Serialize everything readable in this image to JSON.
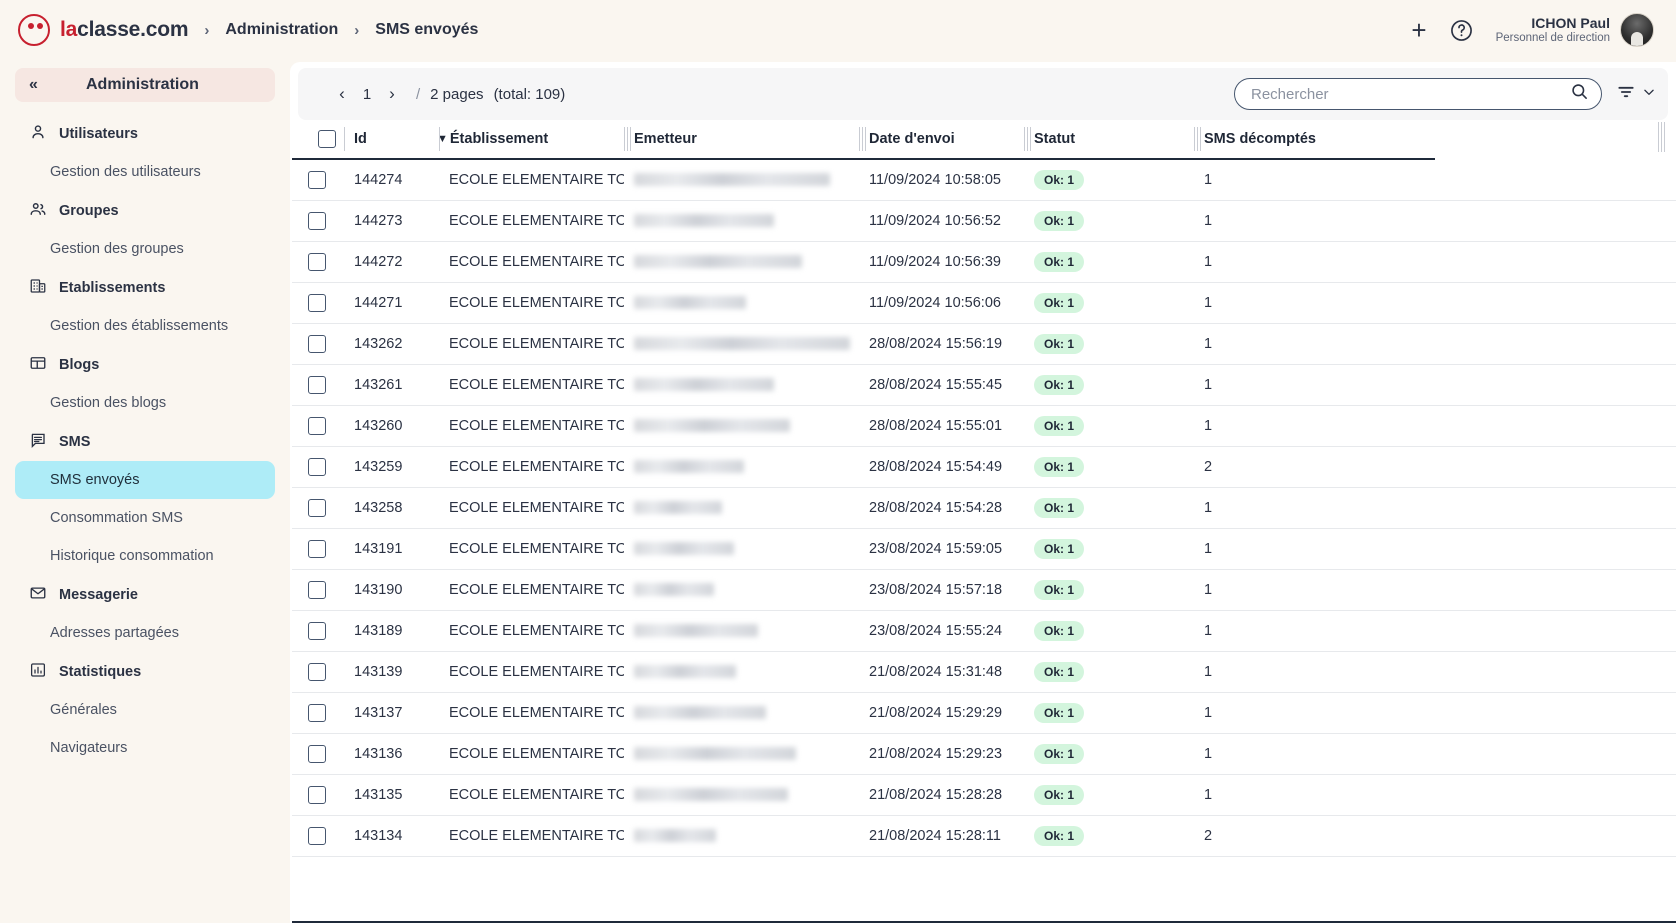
{
  "header": {
    "brand_prefix": "la",
    "brand_suffix": "classe.com",
    "breadcrumb": [
      "Administration",
      "SMS envoyés"
    ],
    "separator": "›",
    "add_label": "+",
    "help_label": "?",
    "user": {
      "name": "ICHON Paul",
      "role": "Personnel de direction"
    }
  },
  "sidebar": {
    "title": "Administration",
    "collapse_label": "«",
    "groups": [
      {
        "icon": "user-icon",
        "label": "Utilisateurs",
        "children": [
          {
            "label": "Gestion des utilisateurs",
            "active": false
          }
        ]
      },
      {
        "icon": "users-icon",
        "label": "Groupes",
        "children": [
          {
            "label": "Gestion des groupes",
            "active": false
          }
        ]
      },
      {
        "icon": "building-icon",
        "label": "Etablissements",
        "children": [
          {
            "label": "Gestion des établissements",
            "active": false
          }
        ]
      },
      {
        "icon": "blog-icon",
        "label": "Blogs",
        "children": [
          {
            "label": "Gestion des blogs",
            "active": false
          }
        ]
      },
      {
        "icon": "sms-icon",
        "label": "SMS",
        "children": [
          {
            "label": "SMS envoyés",
            "active": true
          },
          {
            "label": "Consommation SMS",
            "active": false
          },
          {
            "label": "Historique consommation",
            "active": false
          }
        ]
      },
      {
        "icon": "mail-icon",
        "label": "Messagerie",
        "children": [
          {
            "label": "Adresses partagées",
            "active": false
          }
        ]
      },
      {
        "icon": "chart-icon",
        "label": "Statistiques",
        "children": [
          {
            "label": "Générales",
            "active": false
          },
          {
            "label": "Navigateurs",
            "active": false
          }
        ]
      }
    ]
  },
  "toolbar": {
    "prev_label": "‹",
    "page_value": "1",
    "next_label": "›",
    "slash": "/",
    "pages_label": "2  pages",
    "total_label": "(total: 109)",
    "search": {
      "value": "",
      "placeholder": "Rechercher"
    },
    "filter_icon": "filter-icon",
    "filter_chevron": "chevron-down-icon"
  },
  "table": {
    "columns": [
      {
        "key": "id",
        "label": "Id",
        "sorted": true,
        "sort_dir": "desc"
      },
      {
        "key": "etablissement",
        "label": "Établissement"
      },
      {
        "key": "emetteur",
        "label": "Emetteur"
      },
      {
        "key": "date",
        "label": "Date d'envoi"
      },
      {
        "key": "statut",
        "label": "Statut"
      },
      {
        "key": "sms",
        "label": "SMS décomptés"
      }
    ],
    "etablissement_text": "ECOLE ELEMENTAIRE TON",
    "rows": [
      {
        "id": "144274",
        "etablissement": "ECOLE ELEMENTAIRE TON",
        "emetteur": "",
        "emetteur_width": 196,
        "date": "11/09/2024 10:58:05",
        "statut": "Ok: 1",
        "sms": "1"
      },
      {
        "id": "144273",
        "etablissement": "ECOLE ELEMENTAIRE TON",
        "emetteur": "",
        "emetteur_width": 140,
        "date": "11/09/2024 10:56:52",
        "statut": "Ok: 1",
        "sms": "1"
      },
      {
        "id": "144272",
        "etablissement": "ECOLE ELEMENTAIRE TON",
        "emetteur": "",
        "emetteur_width": 168,
        "date": "11/09/2024 10:56:39",
        "statut": "Ok: 1",
        "sms": "1"
      },
      {
        "id": "144271",
        "etablissement": "ECOLE ELEMENTAIRE TON",
        "emetteur": "",
        "emetteur_width": 112,
        "date": "11/09/2024 10:56:06",
        "statut": "Ok: 1",
        "sms": "1"
      },
      {
        "id": "143262",
        "etablissement": "ECOLE ELEMENTAIRE TON",
        "emetteur": "",
        "emetteur_width": 216,
        "date": "28/08/2024 15:56:19",
        "statut": "Ok: 1",
        "sms": "1"
      },
      {
        "id": "143261",
        "etablissement": "ECOLE ELEMENTAIRE TON",
        "emetteur": "",
        "emetteur_width": 140,
        "date": "28/08/2024 15:55:45",
        "statut": "Ok: 1",
        "sms": "1"
      },
      {
        "id": "143260",
        "etablissement": "ECOLE ELEMENTAIRE TON",
        "emetteur": "",
        "emetteur_width": 156,
        "date": "28/08/2024 15:55:01",
        "statut": "Ok: 1",
        "sms": "1"
      },
      {
        "id": "143259",
        "etablissement": "ECOLE ELEMENTAIRE TON",
        "emetteur": "",
        "emetteur_width": 110,
        "date": "28/08/2024 15:54:49",
        "statut": "Ok: 1",
        "sms": "2"
      },
      {
        "id": "143258",
        "etablissement": "ECOLE ELEMENTAIRE TON",
        "emetteur": "",
        "emetteur_width": 88,
        "date": "28/08/2024 15:54:28",
        "statut": "Ok: 1",
        "sms": "1"
      },
      {
        "id": "143191",
        "etablissement": "ECOLE ELEMENTAIRE TON",
        "emetteur": "",
        "emetteur_width": 100,
        "date": "23/08/2024 15:59:05",
        "statut": "Ok: 1",
        "sms": "1"
      },
      {
        "id": "143190",
        "etablissement": "ECOLE ELEMENTAIRE TON",
        "emetteur": "",
        "emetteur_width": 80,
        "date": "23/08/2024 15:57:18",
        "statut": "Ok: 1",
        "sms": "1"
      },
      {
        "id": "143189",
        "etablissement": "ECOLE ELEMENTAIRE TON",
        "emetteur": "",
        "emetteur_width": 124,
        "date": "23/08/2024 15:55:24",
        "statut": "Ok: 1",
        "sms": "1"
      },
      {
        "id": "143139",
        "etablissement": "ECOLE ELEMENTAIRE TON",
        "emetteur": "",
        "emetteur_width": 102,
        "date": "21/08/2024 15:31:48",
        "statut": "Ok: 1",
        "sms": "1"
      },
      {
        "id": "143137",
        "etablissement": "ECOLE ELEMENTAIRE TON",
        "emetteur": "",
        "emetteur_width": 132,
        "date": "21/08/2024 15:29:29",
        "statut": "Ok: 1",
        "sms": "1"
      },
      {
        "id": "143136",
        "etablissement": "ECOLE ELEMENTAIRE TON",
        "emetteur": "",
        "emetteur_width": 162,
        "date": "21/08/2024 15:29:23",
        "statut": "Ok: 1",
        "sms": "1"
      },
      {
        "id": "143135",
        "etablissement": "ECOLE ELEMENTAIRE TON",
        "emetteur": "",
        "emetteur_width": 154,
        "date": "21/08/2024 15:28:28",
        "statut": "Ok: 1",
        "sms": "1"
      },
      {
        "id": "143134",
        "etablissement": "ECOLE ELEMENTAIRE TON",
        "emetteur": "",
        "emetteur_width": 82,
        "date": "21/08/2024 15:28:11",
        "statut": "Ok: 1",
        "sms": "2"
      }
    ]
  },
  "colors": {
    "brand_red": "#c7202f",
    "page_bg": "#faf6f0",
    "active_nav": "#aeecf7",
    "badge_ok_bg": "#d3f5dd",
    "text_dark": "#2b3243"
  }
}
